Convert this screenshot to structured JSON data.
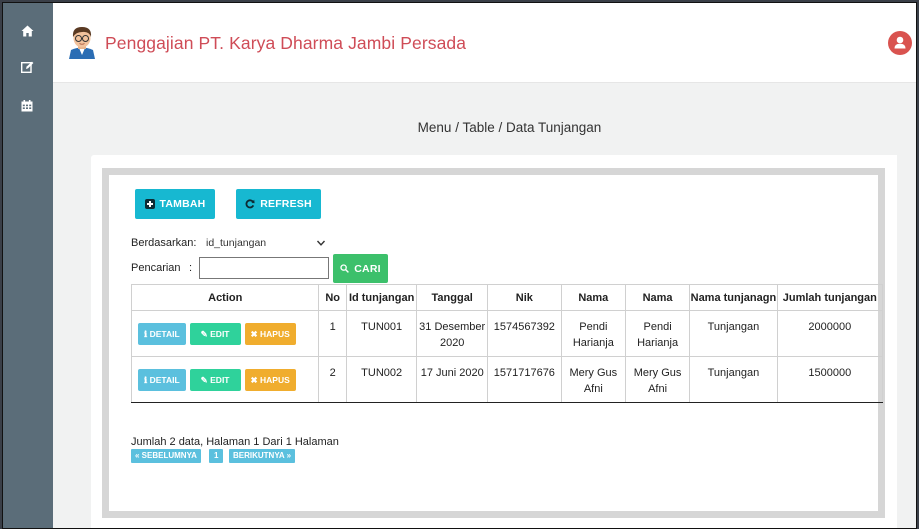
{
  "app": {
    "title": "Penggajian PT. Karya Dharma Jambi Persada"
  },
  "sidebar": {
    "icons": [
      "home-icon",
      "edit-icon",
      "calendar-icon"
    ]
  },
  "breadcrumb": "Menu / Table / Data Tunjangan",
  "toolbar": {
    "tambah_label": "TAMBAH",
    "refresh_label": "REFRESH"
  },
  "filter": {
    "berdasarkan_label": "Berdasarkan:",
    "berdasarkan_value": "id_tunjangan",
    "pencarian_label": "Pencarian",
    "pencarian_colon": ":",
    "search_value": "",
    "cari_label": "CARI"
  },
  "table": {
    "headers": [
      "Action",
      "No",
      "Id tunjangan",
      "Tanggal",
      "Nik",
      "Nama",
      "Nama",
      "Nama tunjanagn",
      "Jumlah tunjangan"
    ],
    "action_labels": {
      "detail": "DETAIL",
      "edit": "EDIT",
      "hapus": "HAPUS"
    },
    "rows": [
      {
        "no": "1",
        "id": "TUN001",
        "tanggal": "31 Desember 2020",
        "nik": "1574567392",
        "nama1": "Pendi Harianja",
        "nama2": "Pendi Harianja",
        "nama_tunjangan": "Tunjangan",
        "jumlah": "2000000"
      },
      {
        "no": "2",
        "id": "TUN002",
        "tanggal": "17 Juni 2020",
        "nik": "1571717676",
        "nama1": "Mery Gus Afni",
        "nama2": "Mery Gus Afni",
        "nama_tunjangan": "Tunjangan",
        "jumlah": "1500000"
      }
    ]
  },
  "summary": "Jumlah 2 data, Halaman 1 Dari 1 Halaman",
  "pagination": {
    "prev": "« SEBELUMNYA",
    "page": "1",
    "next": "BERIKUTNYA »"
  },
  "colors": {
    "sidebar": "#5b6d79",
    "title": "#cf4c57",
    "cyan": "#17b8d1",
    "green": "#3cc06b",
    "detail": "#5bc0de",
    "edit": "#2fd29b",
    "hapus": "#f0ad2e",
    "user": "#d9534f"
  }
}
